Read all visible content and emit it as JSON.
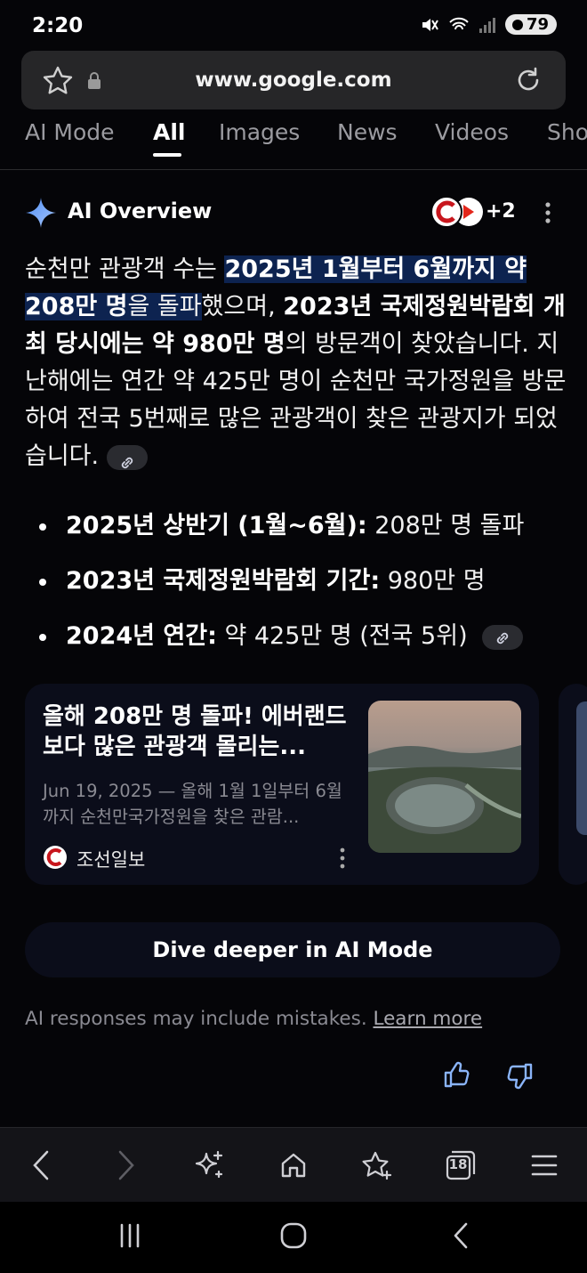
{
  "status_bar": {
    "time": "2:20",
    "battery": "79"
  },
  "url_bar": {
    "url": "www.google.com"
  },
  "tabs": [
    {
      "label": "AI Mode"
    },
    {
      "label": "All"
    },
    {
      "label": "Images"
    },
    {
      "label": "News"
    },
    {
      "label": "Videos"
    },
    {
      "label": "Sho"
    }
  ],
  "ai_overview": {
    "title": "AI Overview",
    "source_count": "+2",
    "paragraph": {
      "p1": "순천만 관광객 수는 ",
      "b1": "2025년 1월부터 6월까지 약 208만 명",
      "p2": "을 돌파",
      "p3": "했으며, ",
      "b2": "2023년 국제정원박람회 개최 당시에는 약 980만 명",
      "p4": "의 방문객이 찾았습니다. 지난해에는 연간 약 425만 명이 순천만 국가정원을 방문하여 전국 5번째로 많은 관광객이 찾은 관광지가 되었습니다."
    },
    "bullets": [
      {
        "bold": "2025년 상반기 (1월~6월):",
        "text": " 208만 명 돌파"
      },
      {
        "bold": "2023년 국제정원박람회 기간:",
        "text": " 980만 명"
      },
      {
        "bold": "2024년 연간:",
        "text": " 약 425만 명 (전국 5위)"
      }
    ],
    "card": {
      "title": "올해 208만 명 돌파! 에버랜드보다 많은 관광객 몰리는...",
      "snippet": "Jun 19, 2025 — 올해 1월 1일부터 6월까지 순천만국가정원을 찾은 관람...",
      "source": "조선일보"
    },
    "dive_button": "Dive deeper in AI Mode",
    "disclaimer": "AI responses may include mistakes. ",
    "learn_more": "Learn more"
  },
  "browser_bar": {
    "tab_count": "18"
  },
  "colors": {
    "accent_blue": "#8ab4f8",
    "highlight": "#0d2350",
    "background": "#050508"
  }
}
